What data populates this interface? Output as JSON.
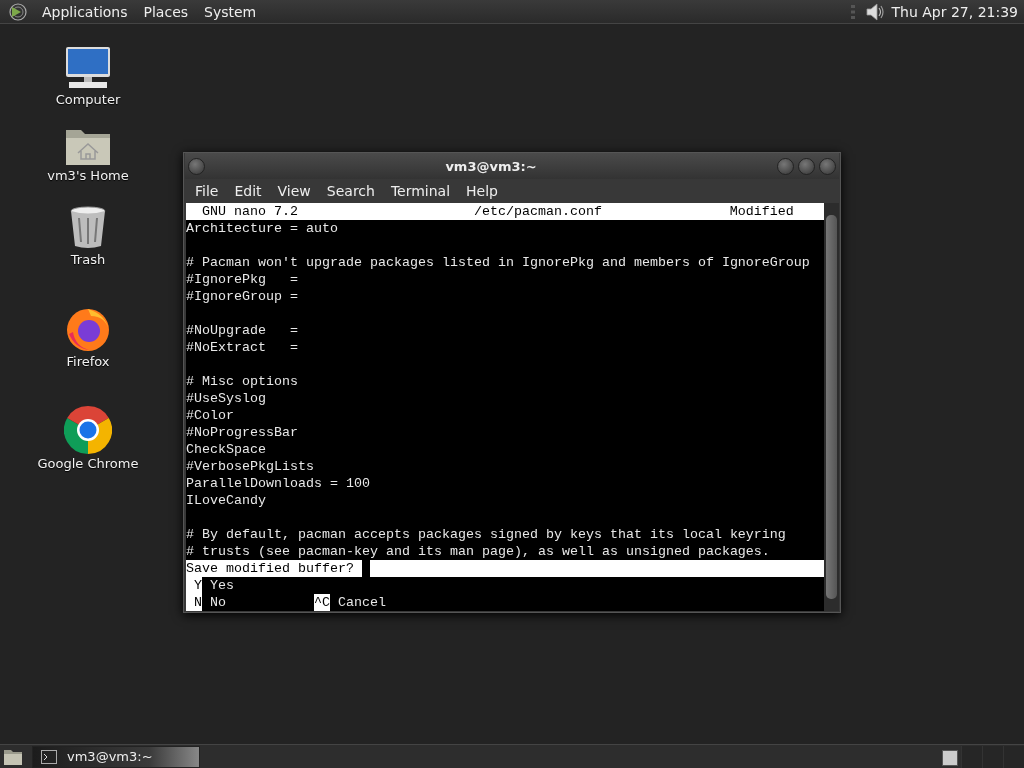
{
  "top_panel": {
    "menus": [
      "Applications",
      "Places",
      "System"
    ],
    "clock": "Thu Apr 27, 21:39"
  },
  "desktop_icons": [
    {
      "label": "Computer",
      "kind": "computer"
    },
    {
      "label": "vm3's Home",
      "kind": "home"
    },
    {
      "label": "Trash",
      "kind": "trash"
    },
    {
      "label": "Firefox",
      "kind": "firefox"
    },
    {
      "label": "Google Chrome",
      "kind": "chrome"
    }
  ],
  "window": {
    "title": "vm3@vm3:~",
    "menu": [
      "File",
      "Edit",
      "View",
      "Search",
      "Terminal",
      "Help"
    ],
    "nano": {
      "version": "GNU nano 7.2",
      "file": "/etc/pacman.conf",
      "status": "Modified",
      "blocks": [
        [
          "Architecture = auto"
        ],
        [
          "# Pacman won't upgrade packages listed in IgnorePkg and members of IgnoreGroup",
          "#IgnorePkg   =",
          "#IgnoreGroup ="
        ],
        [
          "#NoUpgrade   =",
          "#NoExtract   ="
        ],
        [
          "# Misc options",
          "#UseSyslog",
          "#Color",
          "#NoProgressBar",
          "CheckSpace",
          "#VerbosePkgLists",
          "ParallelDownloads = 100",
          "ILoveCandy"
        ],
        [
          "# By default, pacman accepts packages signed by keys that its local keyring",
          "# trusts (see pacman-key and its man page), as well as unsigned packages."
        ]
      ],
      "prompt": "Save modified buffer?",
      "option_rows": [
        [
          {
            "key": "Y",
            "label": "Yes"
          }
        ],
        [
          {
            "key": "N",
            "label": "No"
          },
          {
            "key": "^C",
            "label": "Cancel"
          }
        ]
      ]
    }
  },
  "taskbar": {
    "tasks": [
      {
        "label": "vm3@vm3:~",
        "selected": true
      }
    ]
  }
}
